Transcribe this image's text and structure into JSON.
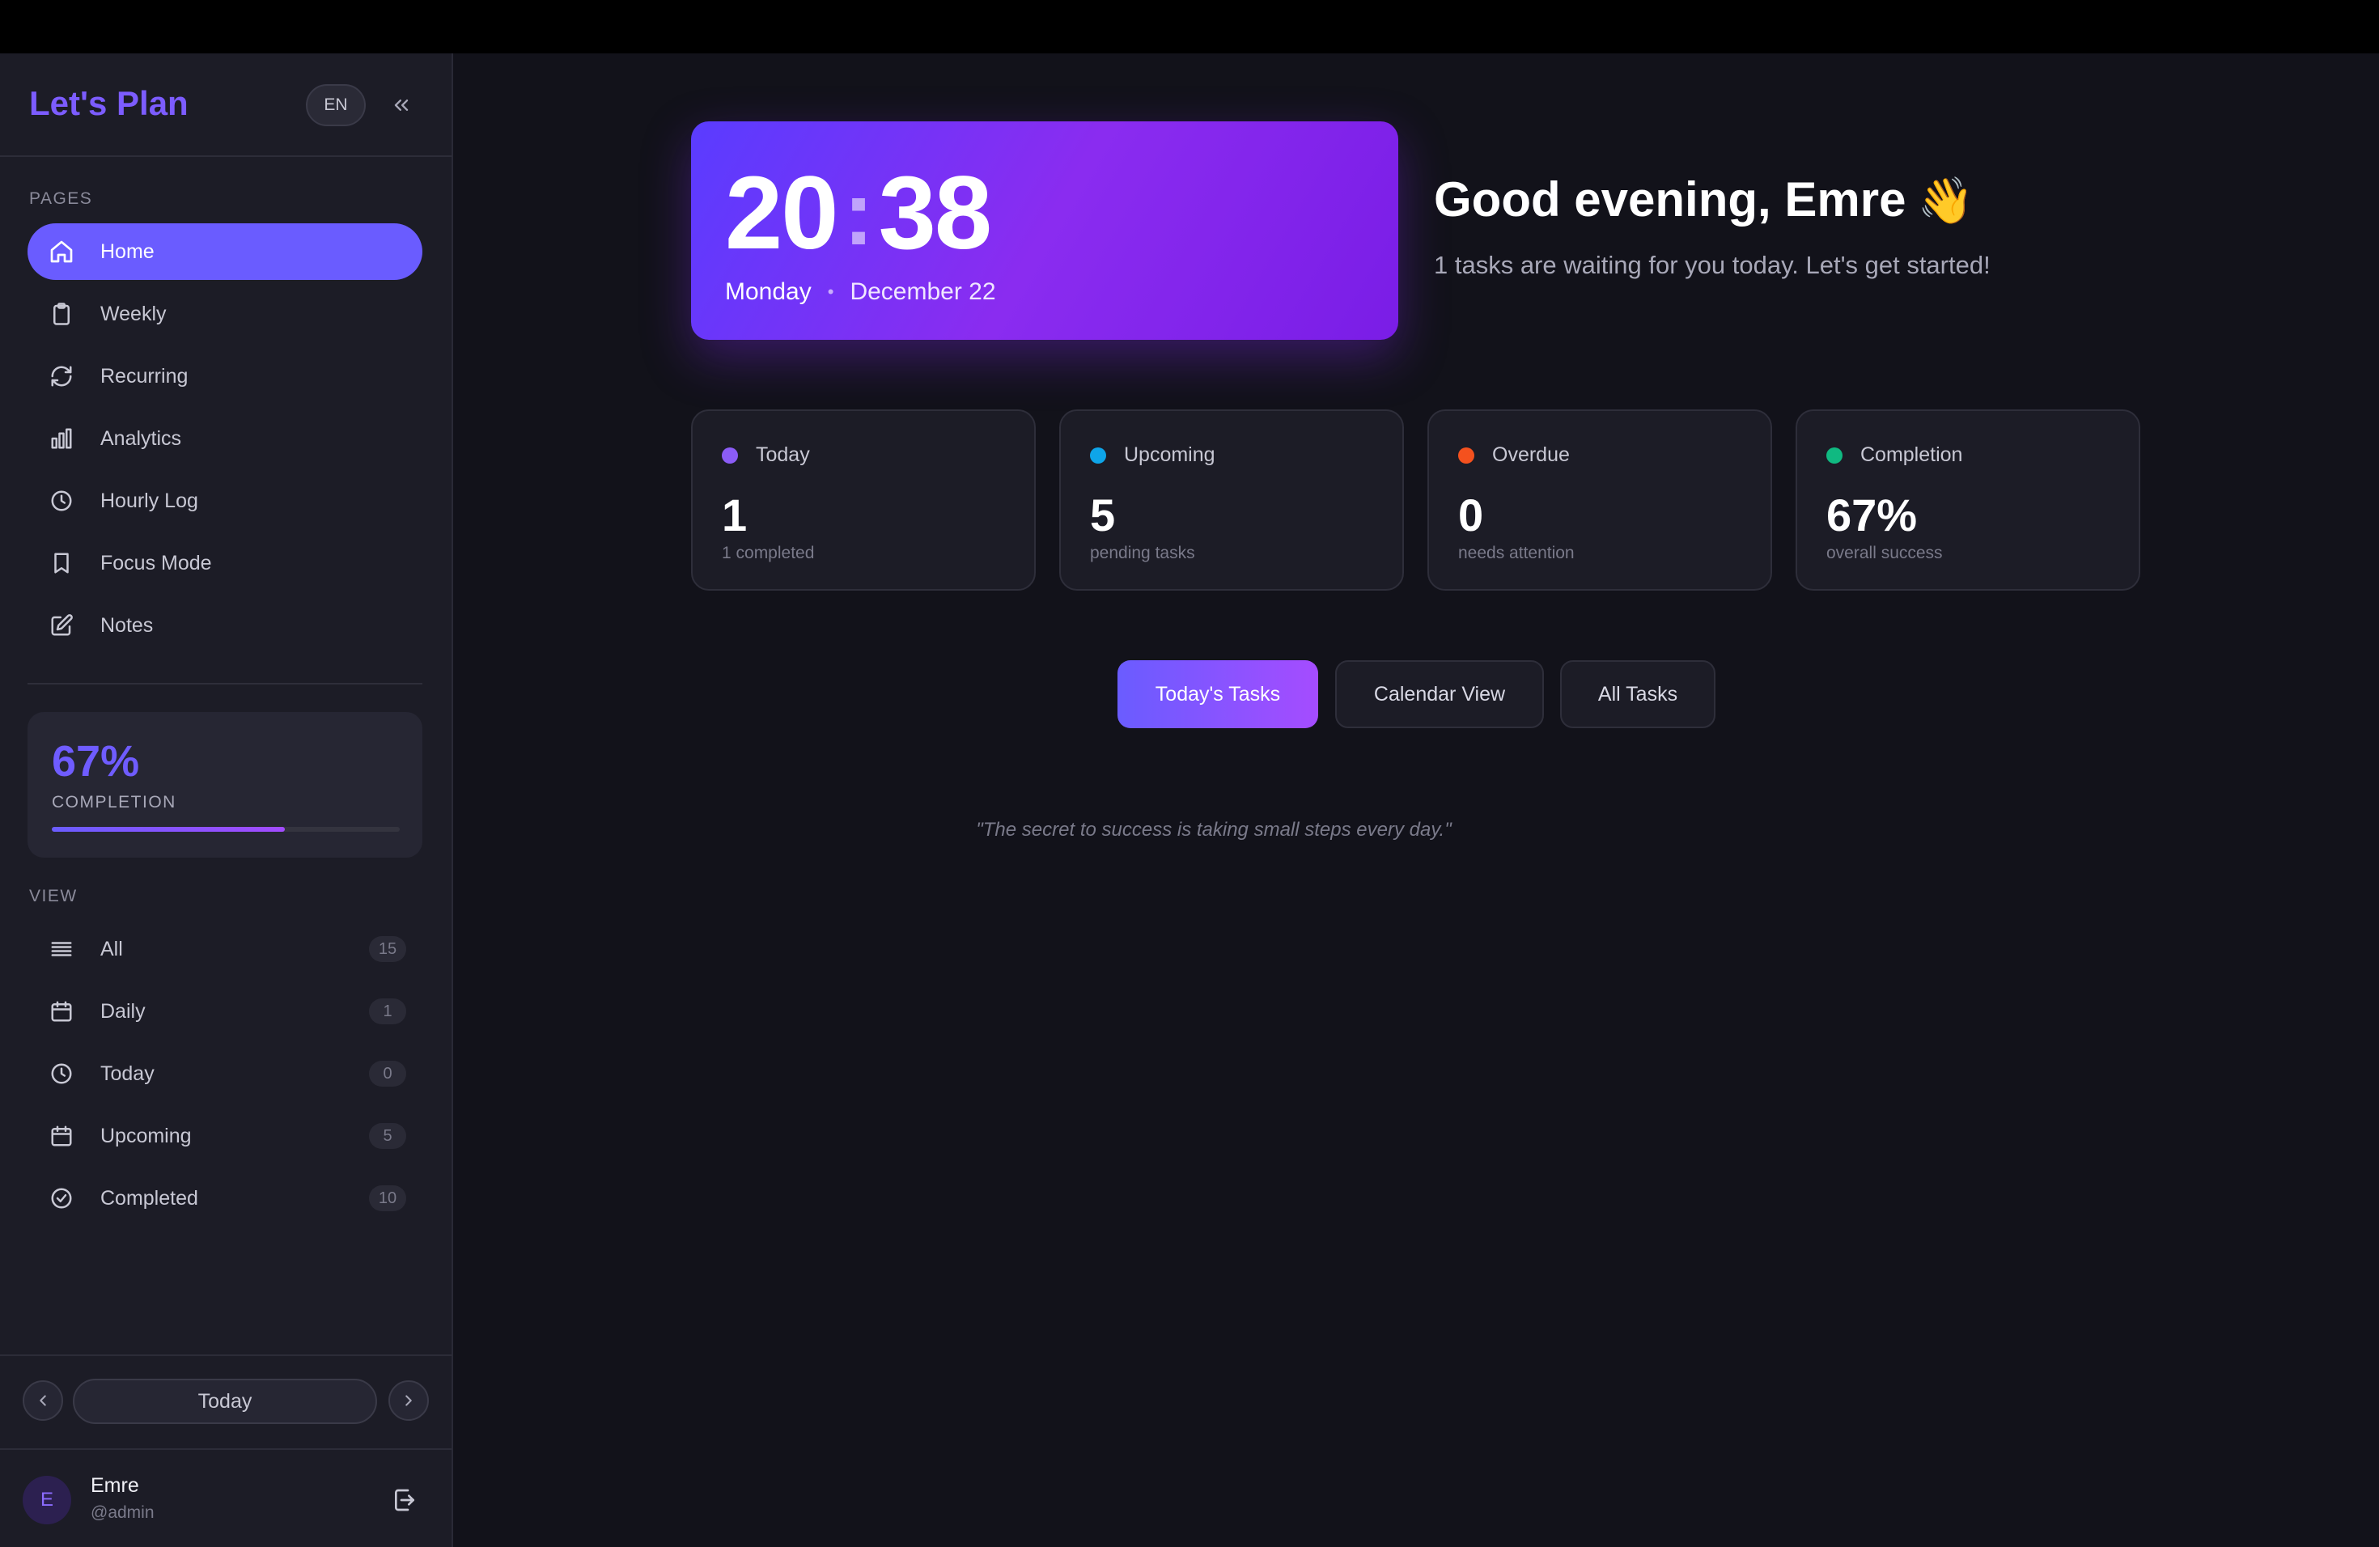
{
  "app": {
    "brand": "Let's Plan",
    "lang": "EN"
  },
  "sidebar": {
    "pages_label": "PAGES",
    "pages": [
      {
        "label": "Home",
        "icon": "home-icon",
        "active": true
      },
      {
        "label": "Weekly",
        "icon": "clipboard-icon"
      },
      {
        "label": "Recurring",
        "icon": "refresh-icon"
      },
      {
        "label": "Analytics",
        "icon": "bar-chart-icon"
      },
      {
        "label": "Hourly Log",
        "icon": "clock-icon"
      },
      {
        "label": "Focus Mode",
        "icon": "bookmark-icon"
      },
      {
        "label": "Notes",
        "icon": "edit-icon"
      }
    ],
    "completion": {
      "value": "67%",
      "label": "COMPLETION",
      "progress": 0.67
    },
    "view_label": "VIEW",
    "views": [
      {
        "label": "All",
        "count": "15",
        "icon": "list-icon"
      },
      {
        "label": "Daily",
        "count": "1",
        "icon": "calendar-icon"
      },
      {
        "label": "Today",
        "count": "0",
        "icon": "clock-icon"
      },
      {
        "label": "Upcoming",
        "count": "5",
        "icon": "calendar-icon"
      },
      {
        "label": "Completed",
        "count": "10",
        "icon": "check-circle-icon"
      }
    ],
    "date_nav": {
      "today_label": "Today"
    },
    "user": {
      "initial": "E",
      "name": "Emre",
      "handle": "@admin"
    }
  },
  "clock": {
    "hours": "20",
    "minutes": "38",
    "day": "Monday",
    "date": "December 22"
  },
  "greeting": {
    "title": "Good evening, Emre",
    "subtitle": "1 tasks are waiting for you today. Let's get started!"
  },
  "stats": [
    {
      "title": "Today",
      "value": "1",
      "sub": "1 completed",
      "color": "#8b5cf6"
    },
    {
      "title": "Upcoming",
      "value": "5",
      "sub": "pending tasks",
      "color": "#0ea5e9"
    },
    {
      "title": "Overdue",
      "value": "0",
      "sub": "needs attention",
      "color": "#f4511e"
    },
    {
      "title": "Completion",
      "value": "67%",
      "sub": "overall success",
      "color": "#10b981"
    }
  ],
  "tabs": [
    {
      "label": "Today's Tasks",
      "active": true
    },
    {
      "label": "Calendar View"
    },
    {
      "label": "All Tasks"
    }
  ],
  "quote": "\"The secret to success is taking small steps every day.\""
}
